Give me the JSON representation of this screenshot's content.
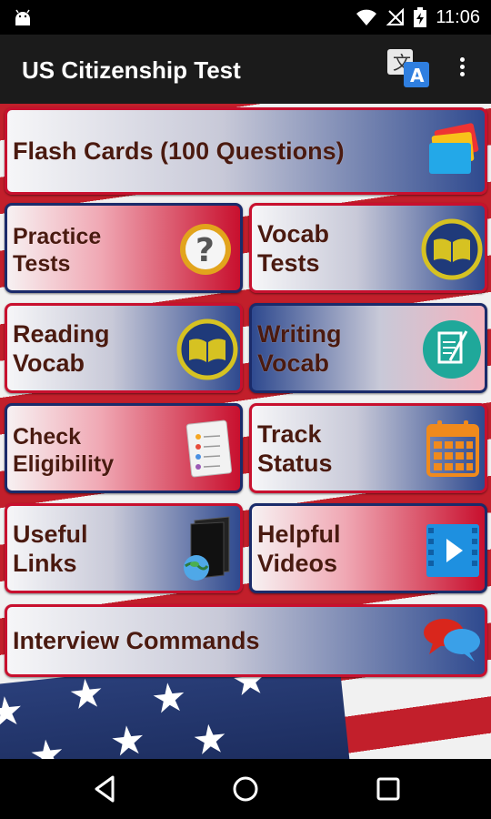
{
  "status_bar": {
    "time": "11:06",
    "icons": [
      "android-icon",
      "wifi-icon",
      "no-signal-icon",
      "battery-charging-icon"
    ]
  },
  "app_bar": {
    "title": "US Citizenship Test",
    "actions": [
      "translate-icon",
      "overflow-menu-icon"
    ]
  },
  "tiles": {
    "flash_cards": {
      "label": "Flash Cards (100 Questions)",
      "icon": "flash-cards-icon"
    },
    "practice_tests": {
      "line1": "Practice",
      "line2": "Tests",
      "icon": "question-mark-icon"
    },
    "vocab_tests": {
      "line1": "Vocab",
      "line2": "Tests",
      "icon": "book-icon"
    },
    "reading_vocab": {
      "line1": "Reading",
      "line2": "Vocab",
      "icon": "book-icon"
    },
    "writing_vocab": {
      "line1": "Writing",
      "line2": "Vocab",
      "icon": "writing-icon"
    },
    "check_eligibility": {
      "line1": "Check",
      "line2": "Eligibility",
      "icon": "checklist-icon"
    },
    "track_status": {
      "line1": "Track",
      "line2": "Status",
      "icon": "calendar-icon"
    },
    "useful_links": {
      "line1": "Useful",
      "line2": "Links",
      "icon": "globe-folder-icon"
    },
    "helpful_videos": {
      "line1": "Helpful",
      "line2": "Videos",
      "icon": "video-play-icon"
    },
    "interview_commands": {
      "label": "Interview Commands",
      "icon": "chat-bubbles-icon"
    }
  },
  "colors": {
    "red": "#c8102e",
    "navy": "#1a2b6a",
    "label_text": "#4a1a10"
  },
  "nav_bar": {
    "buttons": [
      "back-icon",
      "home-icon",
      "recents-icon"
    ]
  }
}
